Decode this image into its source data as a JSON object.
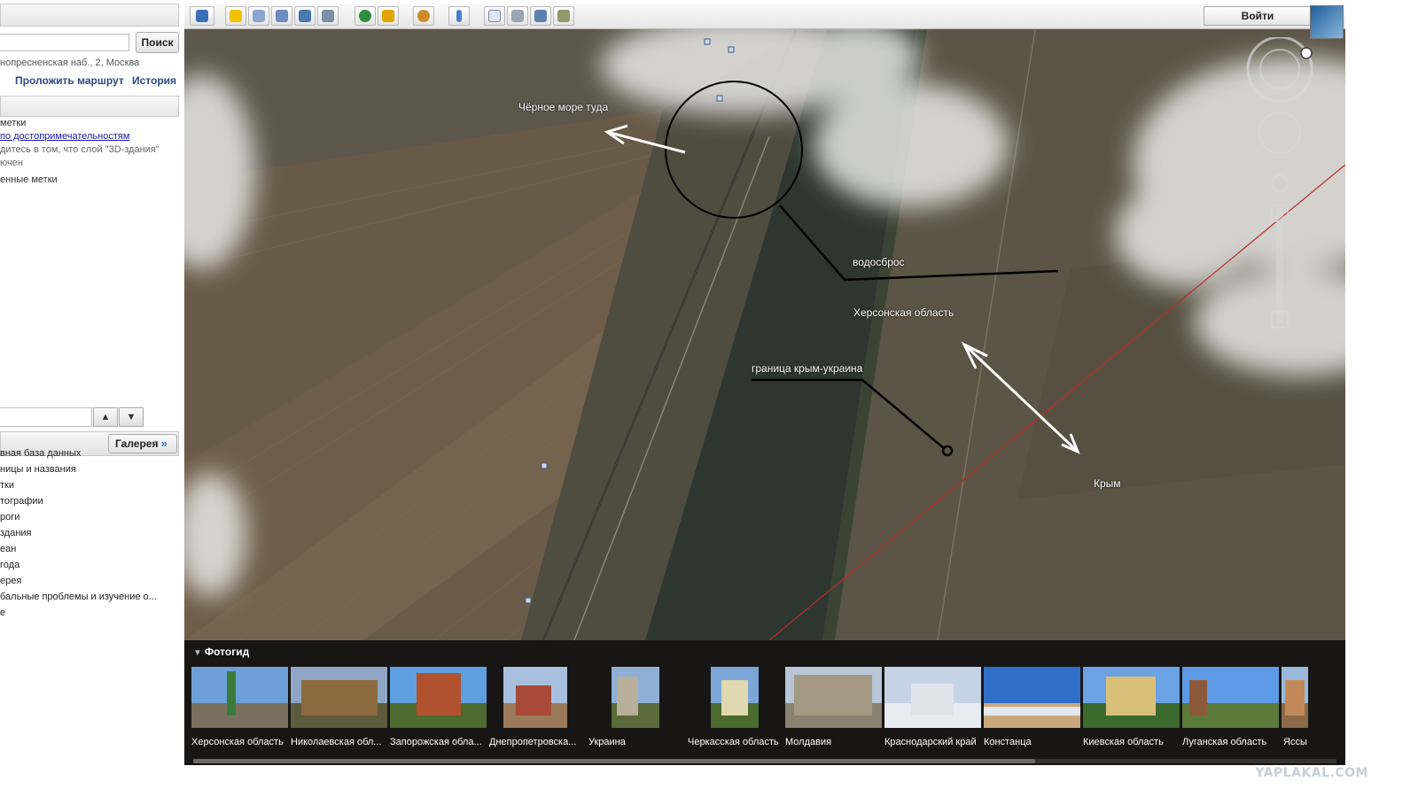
{
  "left_panel": {
    "search_button": "Поиск",
    "address": "нопресненская наб., 2, Москва",
    "route_link": "Проложить маршрут",
    "history_link": "История",
    "places": {
      "item1": "метки",
      "link": "по достопримечательностям",
      "note_line1": "дитесь в том, что слой \"3D-здания\"",
      "note_line2": "ючен",
      "item2": "енные метки"
    },
    "nav_up": "▲",
    "nav_down": "▼",
    "gallery_button": "Галерея",
    "layers": [
      "вная база данных",
      "ницы и названия",
      "тки",
      "тографии",
      "роги",
      "здания",
      "еан",
      "года",
      "ерея",
      "бальные проблемы и изучение о...",
      "е"
    ]
  },
  "toolbar": {
    "login_button": "Войти",
    "icons": [
      "sidebar-icon",
      "placemark-icon",
      "polygon-icon",
      "path-icon",
      "overlay-icon",
      "record-tour-icon",
      "historical-imagery-icon",
      "sun-icon",
      "planets-icon",
      "ruler-icon",
      "email-icon",
      "print-icon",
      "google-maps-icon",
      "save-image-icon"
    ]
  },
  "annotations": {
    "black_sea": "Чёрное море туда",
    "spillway": "водосброс",
    "kherson": "Херсонская область",
    "border": "граница крым-украина",
    "crimea": "Крым"
  },
  "photo_guide": {
    "title": "Фотогид",
    "items": [
      "Херсонская область",
      "Николаевская обл...",
      "Запорожская обла...",
      "Днепропетровска...",
      "Украина",
      "Черкасская область",
      "Молдавия",
      "Краснодарский край",
      "Констанца",
      "Киевская область",
      "Луганская область",
      "Яссы"
    ]
  },
  "watermark": "YAPLAKAL.COM",
  "colors": {
    "link": "#2c4a86",
    "border_line": "#c0282a",
    "annotation": "#ffffff"
  }
}
